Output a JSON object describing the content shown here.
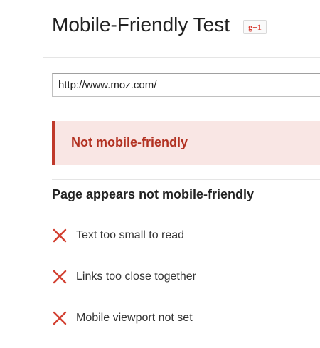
{
  "header": {
    "title": "Mobile-Friendly Test",
    "gplus_label": "g+1"
  },
  "url_input": {
    "value": "http://www.moz.com/"
  },
  "result": {
    "status_text": "Not mobile-friendly",
    "accent_color": "#c0392b",
    "background_color": "#f9e6e4"
  },
  "details": {
    "heading": "Page appears not mobile-friendly",
    "issues": [
      {
        "label": "Text too small to read",
        "icon": "x-icon"
      },
      {
        "label": "Links too close together",
        "icon": "x-icon"
      },
      {
        "label": "Mobile viewport not set",
        "icon": "x-icon"
      }
    ],
    "icon_color": "#d23f31"
  }
}
